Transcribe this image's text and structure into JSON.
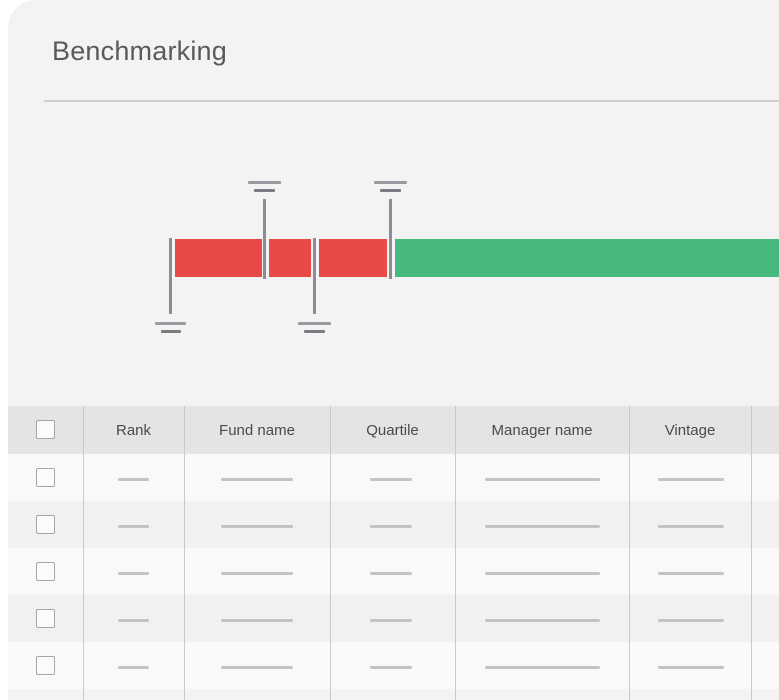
{
  "page": {
    "title": "Benchmarking"
  },
  "benchmark": {
    "quartile_bar": [
      "red",
      "red",
      "red",
      "green"
    ],
    "colors": {
      "below": "#e84a48",
      "above": "#47b97f",
      "marker": "#8c8c92"
    }
  },
  "table": {
    "columns": [
      "Rank",
      "Fund name",
      "Quartile",
      "Manager name",
      "Vintage"
    ],
    "row_count": 5,
    "cells_are_placeholders": true
  }
}
